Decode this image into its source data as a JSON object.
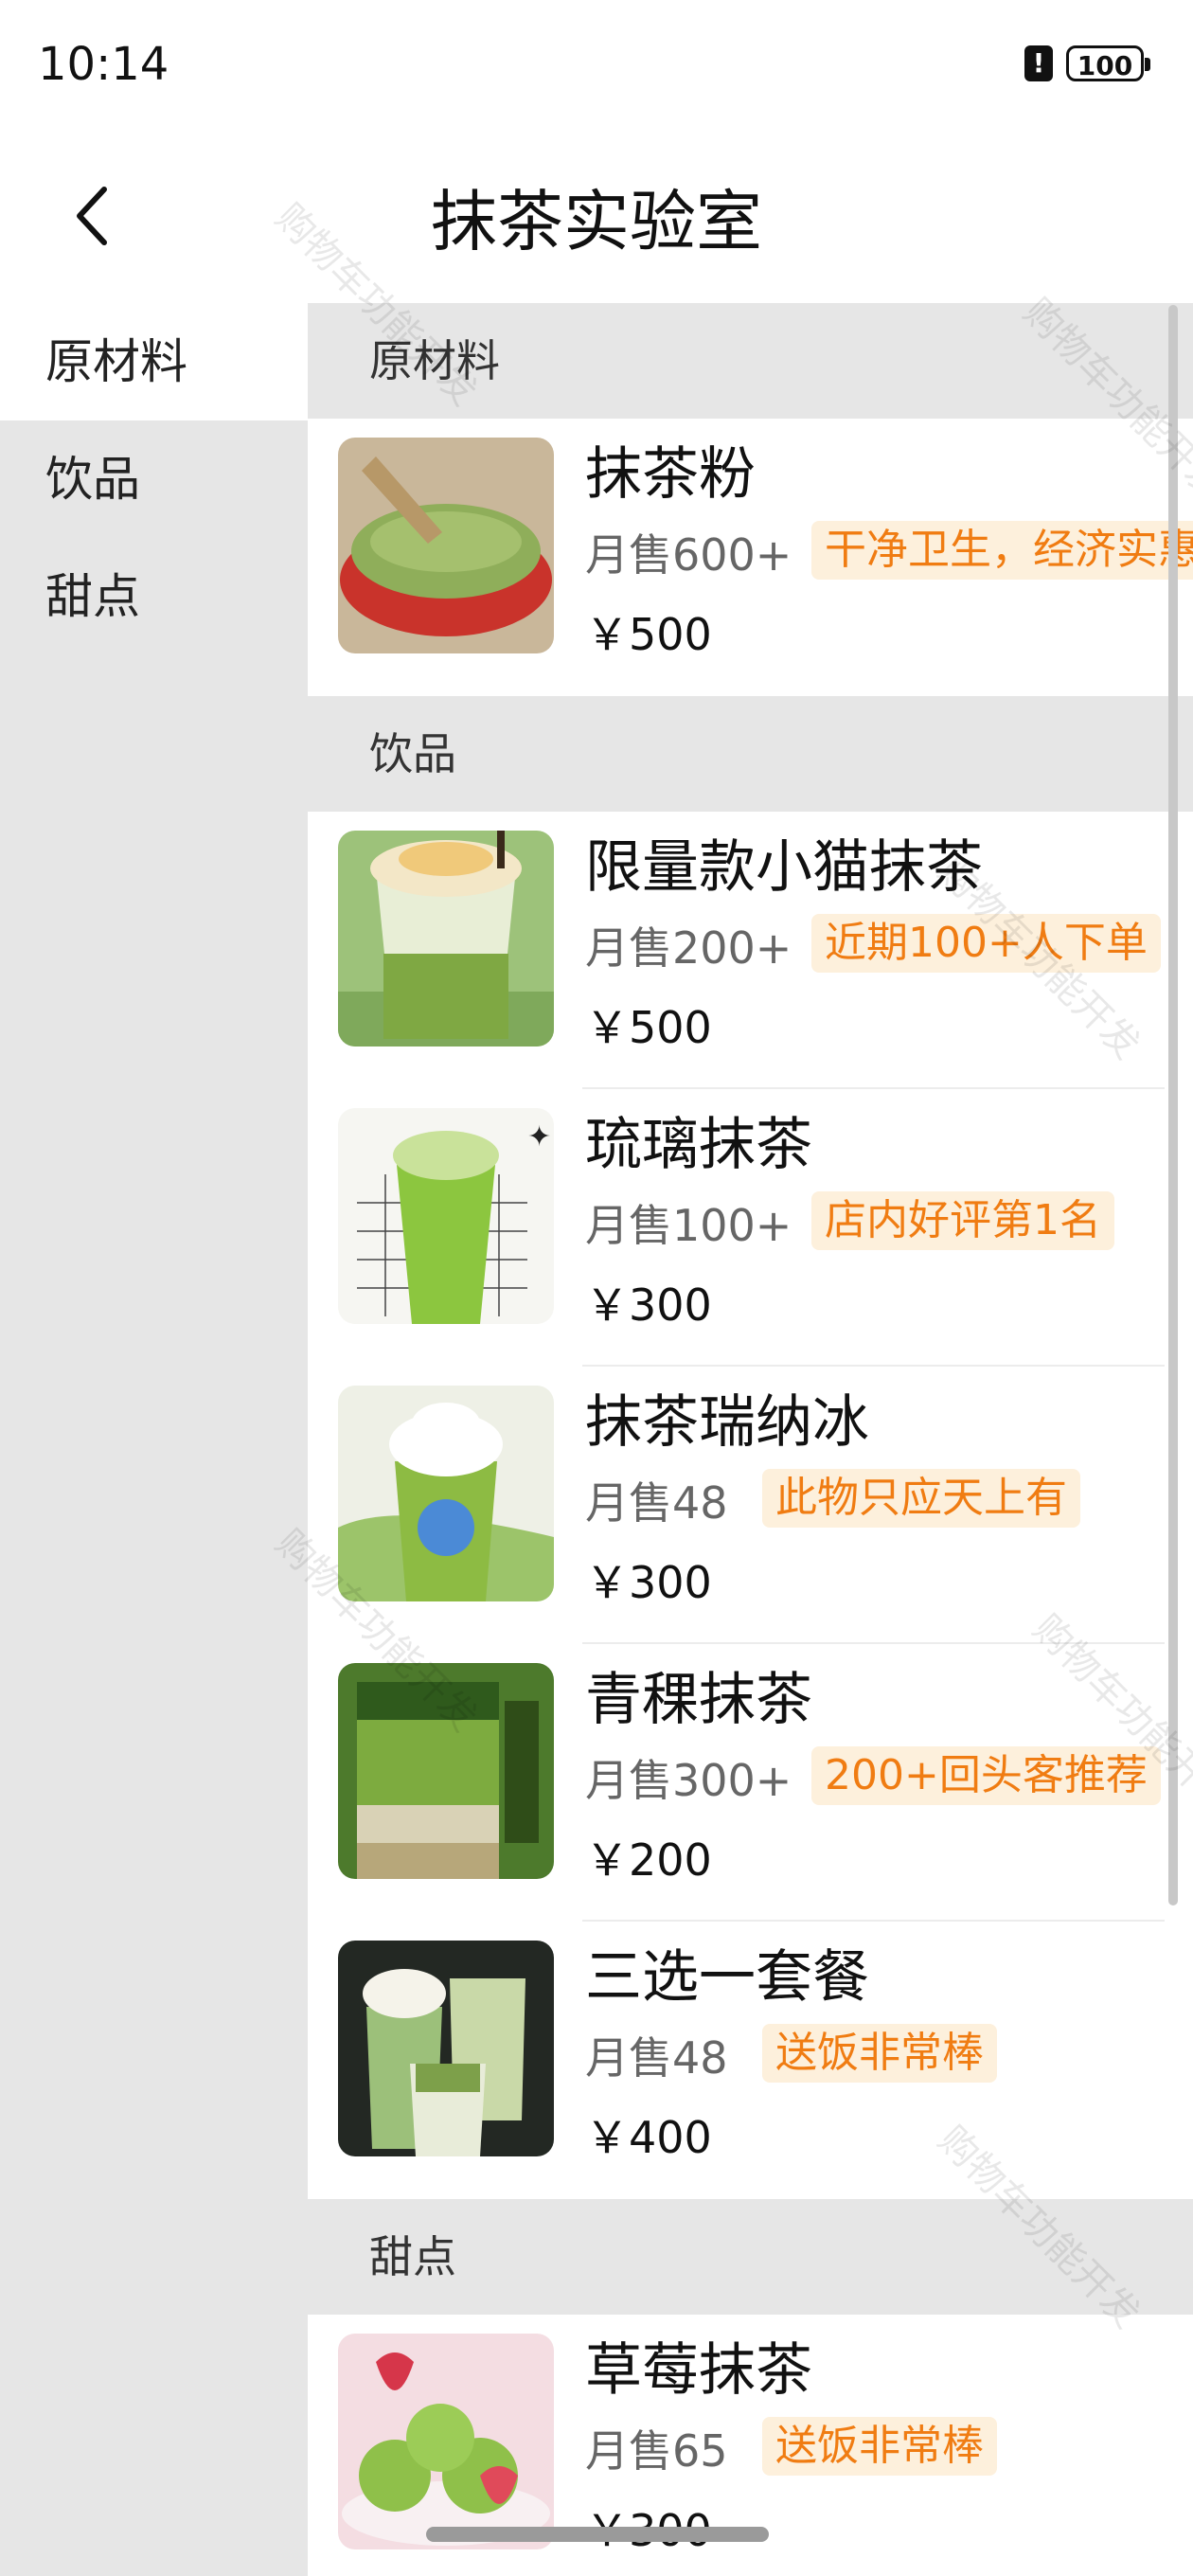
{
  "status_bar": {
    "time": "10:14",
    "battery": "100"
  },
  "header": {
    "title": "抹茶实验室"
  },
  "sidebar": {
    "items": [
      {
        "label": "原材料",
        "active": true
      },
      {
        "label": "饮品",
        "active": false
      },
      {
        "label": "甜点",
        "active": false
      }
    ]
  },
  "sections": [
    {
      "title": "原材料",
      "items": [
        {
          "name": "抹茶粉",
          "sales": "月售600+",
          "tag": "干净卫生，经济实惠",
          "price": "￥500"
        }
      ]
    },
    {
      "title": "饮品",
      "items": [
        {
          "name": "限量款小猫抹茶",
          "sales": "月售200+",
          "tag": "近期100+人下单",
          "price": "￥500"
        },
        {
          "name": "琉璃抹茶",
          "sales": "月售100+",
          "tag": "店内好评第1名",
          "price": "￥300"
        },
        {
          "name": "抹茶瑞纳冰",
          "sales": "月售48",
          "tag": "此物只应天上有",
          "price": "￥300"
        },
        {
          "name": "青稞抹茶",
          "sales": "月售300+",
          "tag": "200+回头客推荐",
          "price": "￥200"
        },
        {
          "name": "三选一套餐",
          "sales": "月售48",
          "tag": "送饭非常棒",
          "price": "￥400"
        }
      ]
    },
    {
      "title": "甜点",
      "items": [
        {
          "name": "草莓抹茶",
          "sales": "月售65",
          "tag": "送饭非常棒",
          "price": "￥300"
        }
      ]
    }
  ],
  "watermark": "购物车功能开发"
}
